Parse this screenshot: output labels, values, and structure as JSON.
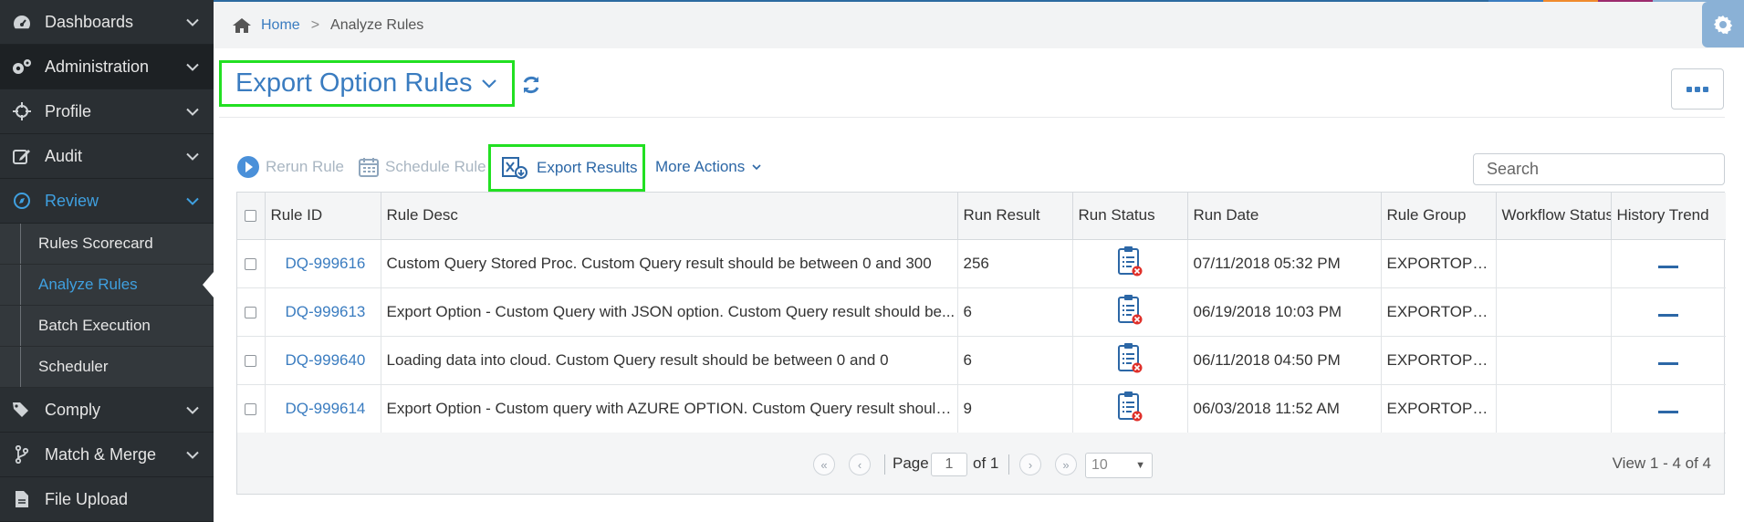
{
  "colors": {
    "accent": "#3a7cc0",
    "highlight": "#22e022",
    "sidebar_bg": "#2a2f33",
    "review_blue": "#3fa0e0"
  },
  "breadcrumb": {
    "home": "Home",
    "current": "Analyze Rules"
  },
  "sidebar": {
    "items": [
      {
        "label": "Dashboards",
        "icon": "dashboard-icon"
      },
      {
        "label": "Administration",
        "icon": "gears-icon"
      },
      {
        "label": "Profile",
        "icon": "crosshair-icon"
      },
      {
        "label": "Audit",
        "icon": "edit-icon"
      },
      {
        "label": "Review",
        "icon": "compass-icon"
      },
      {
        "label": "Comply",
        "icon": "tags-icon"
      },
      {
        "label": "Match & Merge",
        "icon": "branch-icon"
      },
      {
        "label": "File Upload",
        "icon": "file-icon"
      }
    ],
    "review_sub": [
      {
        "label": "Rules Scorecard"
      },
      {
        "label": "Analyze Rules"
      },
      {
        "label": "Batch Execution"
      },
      {
        "label": "Scheduler"
      }
    ]
  },
  "page": {
    "title": "Export Option Rules"
  },
  "toolbar": {
    "rerun": "Rerun Rule",
    "schedule": "Schedule Rule",
    "export": "Export Results",
    "more_actions": "More Actions",
    "search_placeholder": "Search"
  },
  "table": {
    "headers": [
      "Rule ID",
      "Rule Desc",
      "Run Result",
      "Run Status",
      "Run Date",
      "Rule Group",
      "Workflow Status",
      "History Trend"
    ],
    "rows": [
      {
        "id": "DQ-999616",
        "desc": "Custom Query Stored Proc. Custom Query result should be between 0 and 300",
        "result": "256",
        "date": "07/11/2018 05:32 PM",
        "group": "EXPORTOPTI...",
        "workflow": ""
      },
      {
        "id": "DQ-999613",
        "desc": "Export Option - Custom Query with JSON option. Custom Query result should be...",
        "result": "6",
        "date": "06/19/2018 10:03 PM",
        "group": "EXPORTOPTI...",
        "workflow": ""
      },
      {
        "id": "DQ-999640",
        "desc": "Loading data into cloud. Custom Query result should be between 0 and 0",
        "result": "6",
        "date": "06/11/2018 04:50 PM",
        "group": "EXPORTOPTI...",
        "workflow": ""
      },
      {
        "id": "DQ-999614",
        "desc": "Export Option - Custom query with AZURE OPTION. Custom Query result should...",
        "result": "9",
        "date": "06/03/2018 11:52 AM",
        "group": "EXPORTOPTI...",
        "workflow": ""
      }
    ]
  },
  "pager": {
    "page_label": "Page",
    "page_value": "1",
    "of_label": "of 1",
    "page_size": "10",
    "view_text": "View 1 - 4 of 4"
  }
}
